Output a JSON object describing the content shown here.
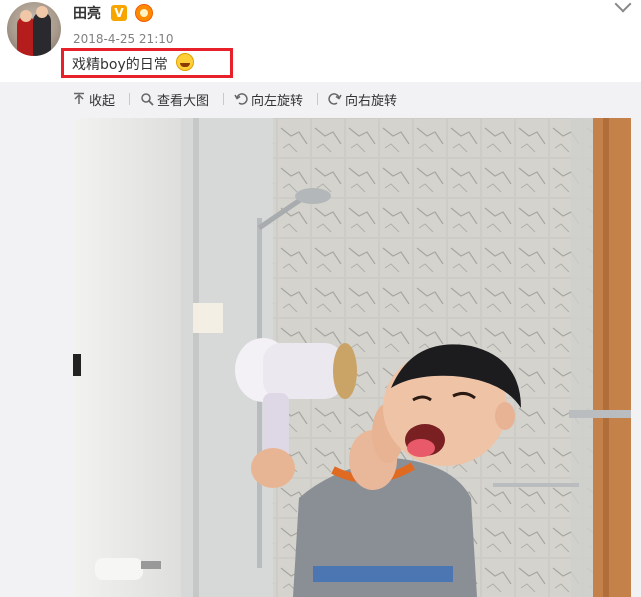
{
  "post": {
    "username": "田亮",
    "verified_badge": "V",
    "timestamp": "2018-4-25 21:10",
    "text": "戏精boy的日常"
  },
  "toolbar": {
    "collapse_label": "收起",
    "view_large_label": "查看大图",
    "rotate_left_label": "向左旋转",
    "rotate_right_label": "向右旋转"
  },
  "colors": {
    "highlight_box": "#e8202a",
    "verified_badge": "#f7a600",
    "username": "#333333",
    "timestamp": "#808080"
  },
  "icons": {
    "avatar": "avatar",
    "level": "level-icon",
    "emoji": "laughing-face-icon",
    "more": "chevron-down-icon",
    "collapse": "collapse-arrow-up-icon",
    "view_large": "magnifier-icon",
    "rotate_left": "rotate-left-icon",
    "rotate_right": "rotate-right-icon"
  }
}
